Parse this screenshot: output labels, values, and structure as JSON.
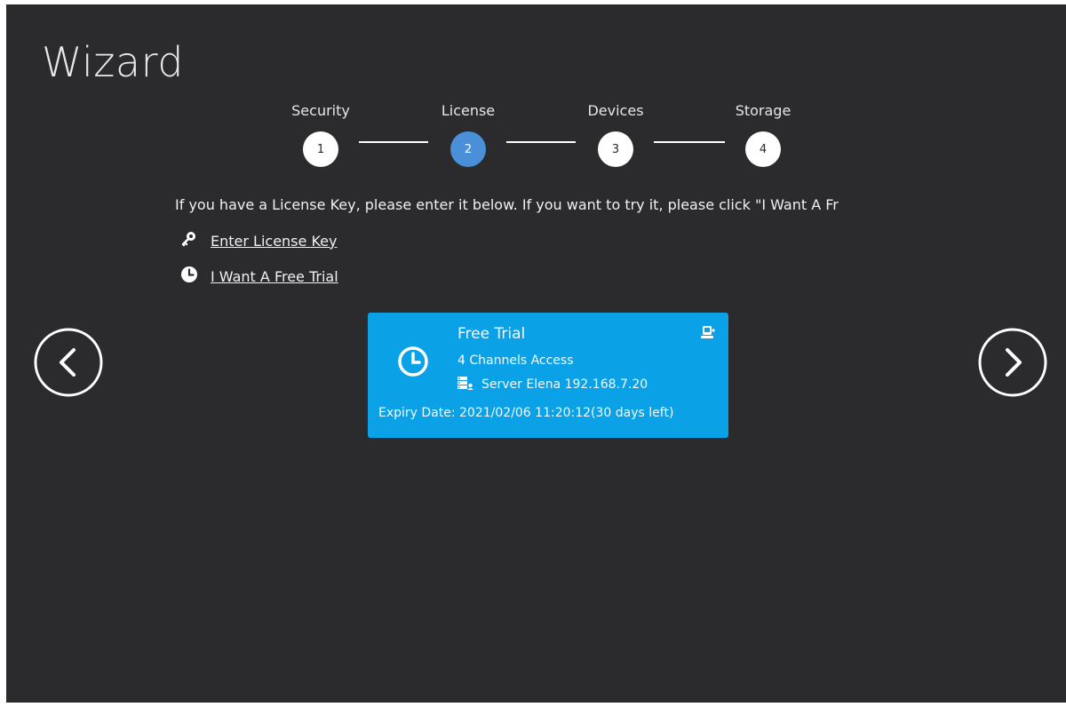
{
  "window": {
    "title": "Wizard"
  },
  "steps": [
    {
      "label": "Security",
      "number": "1",
      "active": false
    },
    {
      "label": "License",
      "number": "2",
      "active": true
    },
    {
      "label": "Devices",
      "number": "3",
      "active": false
    },
    {
      "label": "Storage",
      "number": "4",
      "active": false
    }
  ],
  "intro_text": "If you have a License Key, please enter it below. If you want to try it, please click \"I Want A Fr",
  "options": {
    "enter_key": {
      "label": "Enter License Key",
      "icon": "key-icon"
    },
    "free_trial": {
      "label": "I Want A Free Trial",
      "icon": "clock-icon"
    }
  },
  "license_card": {
    "name": "Free Trial",
    "channels": "4 Channels Access",
    "server": "Server Elena 192.168.7.20",
    "expiry": "Expiry Date: 2021/02/06 11:20:12(30 days left)",
    "color": "#0aa1e6"
  },
  "navigation": {
    "prev_icon": "chevron-left-circle-icon",
    "next_icon": "chevron-right-circle-icon"
  },
  "colors": {
    "background": "#2b2b2e",
    "active_step": "#4a90d9",
    "card": "#0aa1e6"
  }
}
